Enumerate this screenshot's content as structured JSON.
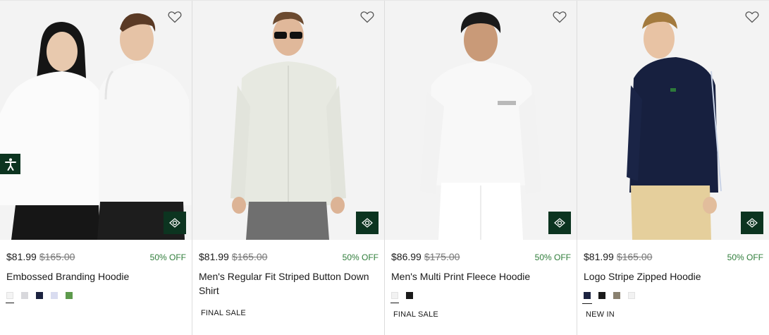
{
  "products": [
    {
      "price": "$81.99",
      "old_price": "$165.00",
      "discount": "50% OFF",
      "title": "Embossed Branding Hoodie",
      "swatches": [
        "#f4f4f4",
        "#d8d8dc",
        "#1c2340",
        "#d9dcf0",
        "#5d9a4c"
      ],
      "selected_swatch": 0,
      "tag": ""
    },
    {
      "price": "$81.99",
      "old_price": "$165.00",
      "discount": "50% OFF",
      "title": "Men's Regular Fit Striped Button Down Shirt",
      "swatches": [],
      "selected_swatch": -1,
      "tag": "FINAL SALE"
    },
    {
      "price": "$86.99",
      "old_price": "$175.00",
      "discount": "50% OFF",
      "title": "Men's Multi Print Fleece Hoodie",
      "swatches": [
        "#f2f2f2",
        "#1a1a1a"
      ],
      "selected_swatch": 0,
      "tag": "FINAL SALE"
    },
    {
      "price": "$81.99",
      "old_price": "$165.00",
      "discount": "50% OFF",
      "title": "Logo Stripe Zipped Hoodie",
      "swatches": [
        "#1c2340",
        "#1a1a1a",
        "#8a8170",
        "#f2f2f2"
      ],
      "selected_swatch": 0,
      "tag": "NEW IN"
    }
  ],
  "icons": {
    "wishlist": "heart-outline-icon",
    "quickview": "eye-icon",
    "accessibility": "accessibility-icon"
  },
  "colors": {
    "brand_green": "#0c3420",
    "discount_green": "#2f7d3a"
  }
}
